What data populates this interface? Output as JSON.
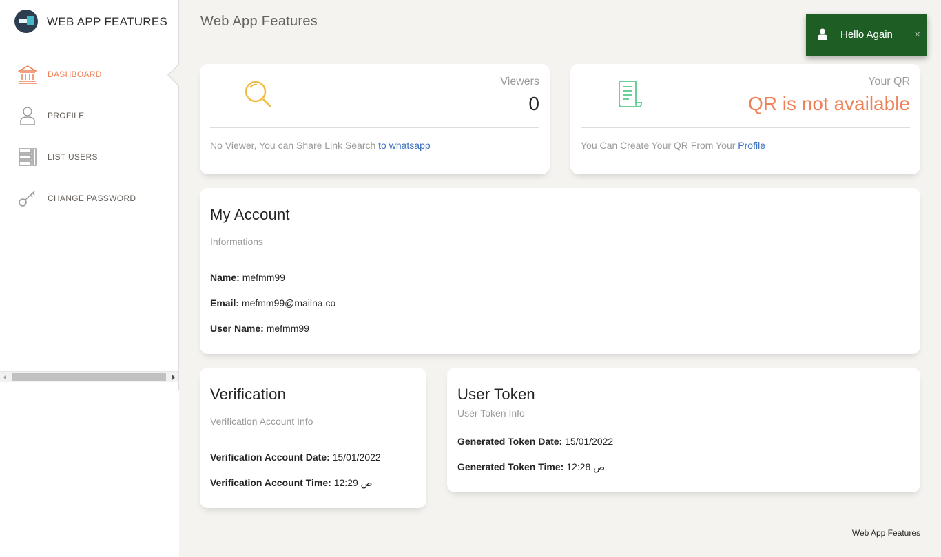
{
  "brand": {
    "name": "WEB APP FEATURES"
  },
  "sidebar": {
    "items": [
      {
        "label": "DASHBOARD",
        "icon": "bank-icon",
        "active": true
      },
      {
        "label": "PROFILE",
        "icon": "user-icon",
        "active": false
      },
      {
        "label": "LIST USERS",
        "icon": "list-icon",
        "active": false
      },
      {
        "label": "CHANGE PASSWORD",
        "icon": "key-icon",
        "active": false
      }
    ]
  },
  "header": {
    "title": "Web App Features"
  },
  "viewers_card": {
    "category": "Viewers",
    "value": "0",
    "footer_text": "No Viewer, You can Share Link Search",
    "footer_link": "to whatsapp",
    "icon": "search-icon",
    "icon_color": "#f3bb45"
  },
  "qr_card": {
    "category": "Your QR",
    "value": "QR is not available",
    "value_color": "#ef8157",
    "footer_text": "You Can Create Your QR From Your",
    "footer_link": "Profile",
    "icon": "document-icon",
    "icon_color": "#6bd098"
  },
  "account": {
    "title": "My Account",
    "subtitle": "Informations",
    "name_label": "Name:",
    "name_value": "mefmm99",
    "email_label": "Email:",
    "email_value": "mefmm99@mailna.co",
    "username_label": "User Name:",
    "username_value": "mefmm99"
  },
  "verification": {
    "title": "Verification",
    "subtitle": "Verification Account Info",
    "date_label": "Verification Account Date:",
    "date_value": "15/01/2022",
    "time_label": "Verification Account Time:",
    "time_value": "12:29 ص"
  },
  "token": {
    "title": "User Token",
    "subtitle": "User Token Info",
    "date_label": "Generated Token Date:",
    "date_value": "15/01/2022",
    "time_label": "Generated Token Time:",
    "time_value": "12:28 ص"
  },
  "toast": {
    "text": "Hello Again",
    "close": "×",
    "icon": "user-icon",
    "bg_color": "#1e5e25"
  },
  "footer": {
    "text": "Web App Features"
  },
  "colors": {
    "accent": "#ef8157",
    "link": "#3b6fbf",
    "background": "#f4f3ef"
  }
}
